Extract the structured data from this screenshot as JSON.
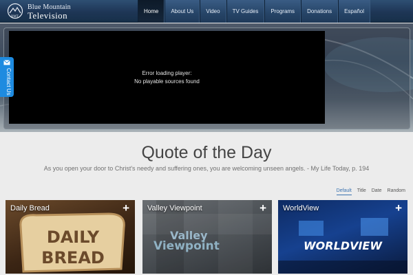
{
  "brand": {
    "line1": "Blue Mountain",
    "line2": "Television"
  },
  "nav": {
    "items": [
      {
        "label": "Home",
        "active": true
      },
      {
        "label": "About Us",
        "active": false
      },
      {
        "label": "Video",
        "active": false
      },
      {
        "label": "TV Guides",
        "active": false
      },
      {
        "label": "Programs",
        "active": false
      },
      {
        "label": "Donations",
        "active": false
      },
      {
        "label": "Español",
        "active": false
      }
    ]
  },
  "player": {
    "error_line1": "Error loading player:",
    "error_line2": "No playable sources found"
  },
  "contact": {
    "label": "Contact Us",
    "icon": "envelope-icon"
  },
  "quote": {
    "title": "Quote of the Day",
    "text": "As you open your door to Christ's needy and suffering ones, you are welcoming unseen angels. - My Life Today, p. 194"
  },
  "sort": {
    "tabs": [
      {
        "label": "Default",
        "active": true
      },
      {
        "label": "Title",
        "active": false
      },
      {
        "label": "Date",
        "active": false
      },
      {
        "label": "Random",
        "active": false
      }
    ]
  },
  "cards": [
    {
      "title": "Daily Bread",
      "art_text": [
        "DAILY",
        "BREAD"
      ],
      "icon": "plus-icon",
      "plus": "+"
    },
    {
      "title": "Valley Viewpoint",
      "art_text": [
        "Valley",
        "Viewpoint"
      ],
      "icon": "plus-icon",
      "plus": "+"
    },
    {
      "title": "WorldView",
      "art_text": [
        "WORLDVIEW"
      ],
      "icon": "plus-icon",
      "plus": "+"
    }
  ],
  "colors": {
    "header": "#1e3656",
    "accent": "#3a72b0",
    "contact_tab": "#1e8be0"
  }
}
